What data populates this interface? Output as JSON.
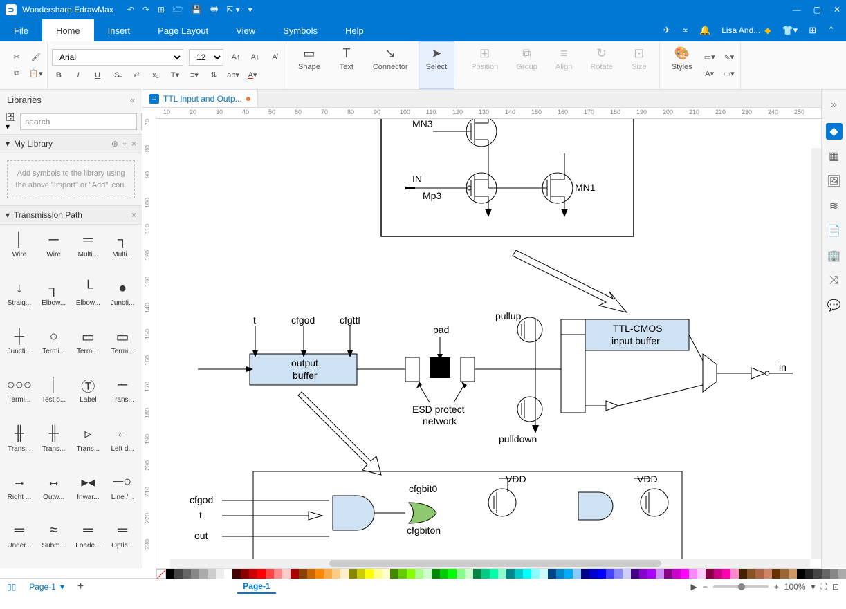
{
  "app": {
    "name": "Wondershare EdrawMax"
  },
  "win": {
    "min": "—",
    "max": "▢",
    "close": "✕"
  },
  "menu": {
    "tabs": [
      "File",
      "Home",
      "Insert",
      "Page Layout",
      "View",
      "Symbols",
      "Help"
    ],
    "active": "Home",
    "user": "Lisa And..."
  },
  "ribbon": {
    "font": "Arial",
    "size": "12",
    "shape": "Shape",
    "text": "Text",
    "connector": "Connector",
    "select": "Select",
    "position": "Position",
    "group": "Group",
    "align": "Align",
    "rotate": "Rotate",
    "size_lbl": "Size",
    "styles": "Styles"
  },
  "left": {
    "title": "Libraries",
    "search_ph": "search",
    "mylib": "My Library",
    "hint": "Add symbols to the library using the above \"Import\" or \"Add\" icon.",
    "section": "Transmission Path",
    "items": [
      {
        "label": "Wire",
        "glyph": "│"
      },
      {
        "label": "Wire",
        "glyph": "─"
      },
      {
        "label": "Multi...",
        "glyph": "═"
      },
      {
        "label": "Multi...",
        "glyph": "┐"
      },
      {
        "label": "Straig...",
        "glyph": "↓"
      },
      {
        "label": "Elbow...",
        "glyph": "┐"
      },
      {
        "label": "Elbow...",
        "glyph": "└"
      },
      {
        "label": "Juncti...",
        "glyph": "●"
      },
      {
        "label": "Juncti...",
        "glyph": "┼"
      },
      {
        "label": "Termi...",
        "glyph": "○"
      },
      {
        "label": "Termi...",
        "glyph": "▭"
      },
      {
        "label": "Termi...",
        "glyph": "▭"
      },
      {
        "label": "Termi...",
        "glyph": "○○○"
      },
      {
        "label": "Test p...",
        "glyph": "│"
      },
      {
        "label": "Label",
        "glyph": "Ⓣ"
      },
      {
        "label": "Trans...",
        "glyph": "─"
      },
      {
        "label": "Trans...",
        "glyph": "╫"
      },
      {
        "label": "Trans...",
        "glyph": "╫"
      },
      {
        "label": "Trans...",
        "glyph": "▹"
      },
      {
        "label": "Left d...",
        "glyph": "←"
      },
      {
        "label": "Right ...",
        "glyph": "→"
      },
      {
        "label": "Outw...",
        "glyph": "↔"
      },
      {
        "label": "Inwar...",
        "glyph": "▸◂"
      },
      {
        "label": "Line /...",
        "glyph": "─○"
      },
      {
        "label": "Under...",
        "glyph": "═"
      },
      {
        "label": "Subm...",
        "glyph": "≈"
      },
      {
        "label": "Loade...",
        "glyph": "═"
      },
      {
        "label": "Optic...",
        "glyph": "═"
      }
    ]
  },
  "doc": {
    "tab": "TTL Input and Outp..."
  },
  "ruler_h": [
    "10",
    "20",
    "30",
    "40",
    "50",
    "60",
    "70",
    "80",
    "90",
    "100",
    "110",
    "120",
    "130",
    "140",
    "150",
    "160",
    "170",
    "180",
    "190",
    "200",
    "210",
    "220",
    "230",
    "240",
    "250"
  ],
  "ruler_v": [
    "70",
    "80",
    "90",
    "100",
    "110",
    "120",
    "130",
    "140",
    "150",
    "160",
    "170",
    "180",
    "190",
    "200",
    "210",
    "220",
    "230"
  ],
  "diagram": {
    "mn3": "MN3",
    "in": "IN",
    "mp3": "Mp3",
    "mn1": "MN1",
    "t": "t",
    "cfgod": "cfgod",
    "cfgttl": "cfgttl",
    "pad": "pad",
    "pullup": "pullup",
    "pulldown": "pulldown",
    "output_buffer_1": "output",
    "output_buffer_2": "buffer",
    "ttl_1": "TTL-CMOS",
    "ttl_2": "input buffer",
    "in_lbl": "in",
    "esd_1": "ESD protect",
    "esd_2": "network",
    "cfgod2": "cfgod",
    "t2": "t",
    "out": "out",
    "cfgbit0": "cfgbit0",
    "cfgbiton": "cfgbiton",
    "vdd1": "VDD",
    "vdd2": "VDD"
  },
  "status": {
    "page": "Page-1",
    "zoom": "100%"
  },
  "colors": [
    "#000",
    "#444",
    "#666",
    "#888",
    "#aaa",
    "#ccc",
    "#eee",
    "#fff",
    "#400",
    "#800",
    "#c00",
    "#f00",
    "#f44",
    "#f88",
    "#fcc",
    "#a00",
    "#840",
    "#c60",
    "#f80",
    "#fa4",
    "#fc8",
    "#fec",
    "#880",
    "#cc0",
    "#ff0",
    "#ff8",
    "#ffc",
    "#480",
    "#6c0",
    "#8f0",
    "#af8",
    "#cfc",
    "#080",
    "#0c0",
    "#0f0",
    "#8f8",
    "#cfc",
    "#084",
    "#0c8",
    "#0fa",
    "#8fc",
    "#088",
    "#0cc",
    "#0ff",
    "#8ff",
    "#cff",
    "#048",
    "#08c",
    "#0af",
    "#8cf",
    "#008",
    "#00c",
    "#00f",
    "#44f",
    "#88f",
    "#ccf",
    "#408",
    "#80c",
    "#a0f",
    "#c8f",
    "#808",
    "#c0c",
    "#f0f",
    "#f8f",
    "#fcf",
    "#804",
    "#c08",
    "#f0a",
    "#f8c",
    "#420",
    "#852",
    "#a64",
    "#c86",
    "#630",
    "#963",
    "#c96"
  ],
  "grays": [
    "#000",
    "#222",
    "#444",
    "#666",
    "#888",
    "#aaa",
    "#ccc",
    "#ddd",
    "#eee",
    "#fff"
  ]
}
